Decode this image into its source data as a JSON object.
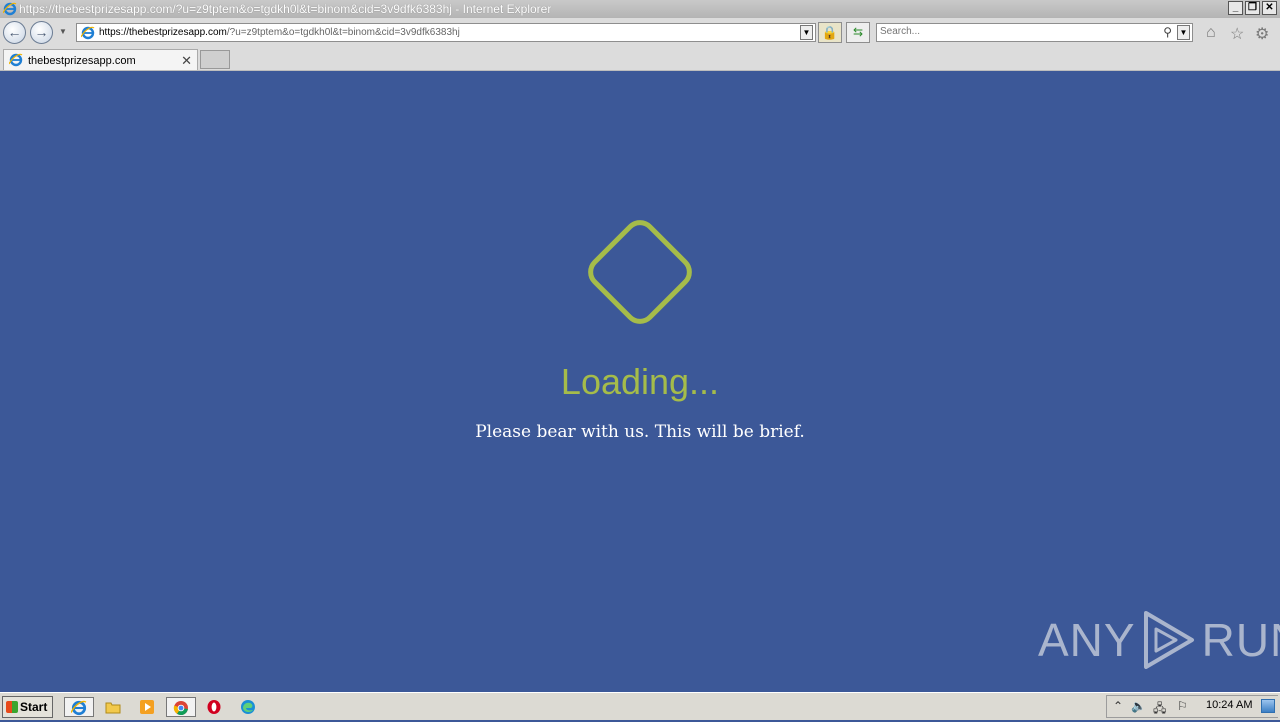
{
  "window": {
    "title": "https://thebestprizesapp.com/?u=z9tptem&o=tgdkh0l&t=binom&cid=3v9dfk6383hj - Internet Explorer",
    "buttons": [
      "_",
      "❐",
      "✕"
    ]
  },
  "navbar": {
    "url_host": "https://thebestprizesapp.com",
    "url_rest": "/?u=z9tptem&o=tgdkh0l&t=binom&cid=3v9dfk6383hj",
    "search_placeholder": "Search..."
  },
  "tabs": [
    {
      "label": "thebestprizesapp.com",
      "active": true
    }
  ],
  "content": {
    "loading_text": "Loading...",
    "subtext": "Please bear with us. This will be brief.",
    "accent_color": "#a5bc4a",
    "background_color": "#3c5898",
    "watermark_left": "ANY",
    "watermark_right": "RUN"
  },
  "taskbar": {
    "start_label": "Start",
    "pinned": [
      "internet-explorer-icon",
      "folder-icon",
      "media-player-icon",
      "chrome-icon",
      "opera-icon",
      "edge-icon"
    ],
    "tray_icons": [
      "chevron-up-icon",
      "speaker-icon",
      "network-icon",
      "flag-icon"
    ],
    "clock": "10:24 AM"
  }
}
